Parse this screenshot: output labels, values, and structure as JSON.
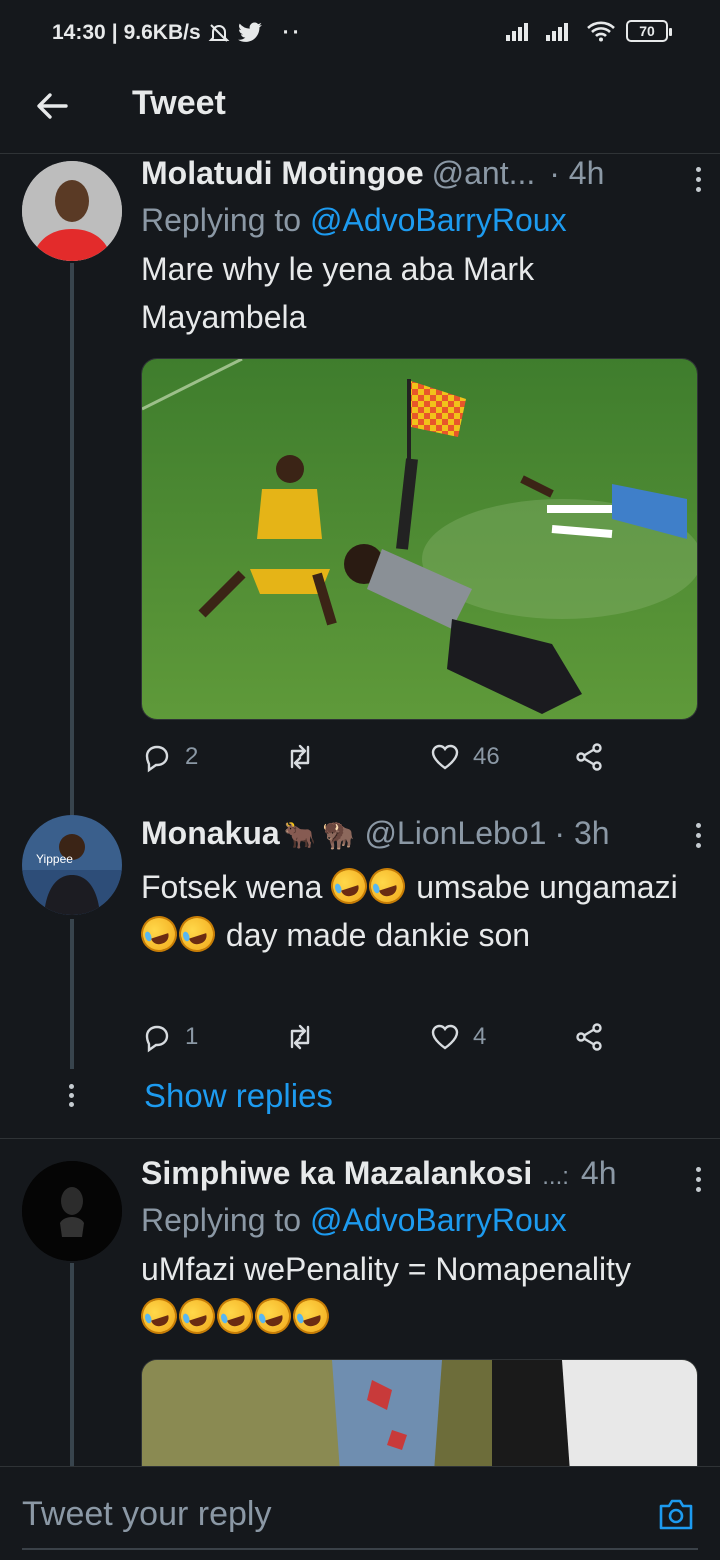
{
  "status_bar": {
    "time": "14:30",
    "speed": "9.6KB/s",
    "battery": "70"
  },
  "header": {
    "back_icon": "arrow-left-icon",
    "title": "Tweet"
  },
  "tweets": [
    {
      "name": "Molatudi Motingoe",
      "handle": "@ant...",
      "time": "· 4h",
      "replying_prefix": "Replying to",
      "replying_to": "@AdvoBarryRoux",
      "text": "Mare why le yena aba Mark Mayambela",
      "replies": "2",
      "retweets": "",
      "likes": "46"
    },
    {
      "name": "Monakua",
      "handle": "@LionLebo1",
      "time": "· 3h",
      "text_parts": [
        "Fotsek wena",
        "umsabe",
        "ungamazi",
        "day made dankie son"
      ],
      "replies": "1",
      "retweets": "",
      "likes": "4",
      "show_replies": "Show replies"
    },
    {
      "name": "Simphiwe ka Mazalankosi",
      "handle": "...:",
      "time": "4h",
      "replying_prefix": "Replying to",
      "replying_to": "@AdvoBarryRoux",
      "text": "uMfazi wePenality = Nomapenality"
    }
  ],
  "composer": {
    "placeholder": "Tweet your reply",
    "camera_icon": "camera-icon"
  },
  "colors": {
    "background": "#15181c",
    "accent": "#1d9bf0",
    "secondary_text": "#8b98a5"
  }
}
